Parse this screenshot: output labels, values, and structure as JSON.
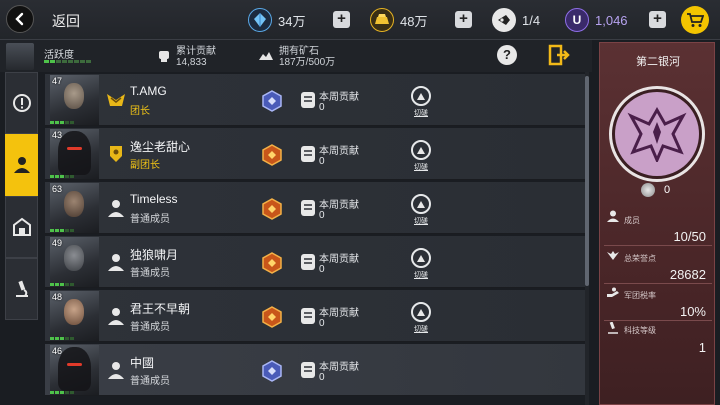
{
  "topbar": {
    "back_label": "返回",
    "crystal": "34万",
    "gold": "48万",
    "energy": "1/4",
    "premium": "1,046"
  },
  "infobar": {
    "activity_label": "活跃度",
    "total_contrib_label": "累计贡献",
    "total_contrib_value": "14,833",
    "ore_label": "拥有矿石",
    "ore_value": "187万/500万"
  },
  "members": [
    {
      "level": "47",
      "name": "T.AMG",
      "role": "团长",
      "role_color": "gold",
      "rank": "leader",
      "contrib_label": "本周贡献",
      "contrib_value": "0",
      "switch_label": "切磋"
    },
    {
      "level": "43",
      "name": "逸尘老甜心",
      "role": "副团长",
      "role_color": "gold",
      "rank": "deputy",
      "contrib_label": "本周贡献",
      "contrib_value": "0",
      "switch_label": "切磋"
    },
    {
      "level": "63",
      "name": "Timeless",
      "role": "普通成员",
      "role_color": "white",
      "rank": "member",
      "contrib_label": "本周贡献",
      "contrib_value": "0",
      "switch_label": "切磋"
    },
    {
      "level": "49",
      "name": "独狼啸月",
      "role": "普通成员",
      "role_color": "white",
      "rank": "member",
      "contrib_label": "本周贡献",
      "contrib_value": "0",
      "switch_label": "切磋"
    },
    {
      "level": "48",
      "name": "君王不早朝",
      "role": "普通成员",
      "role_color": "white",
      "rank": "member",
      "contrib_label": "本周贡献",
      "contrib_value": "0",
      "switch_label": "切磋"
    },
    {
      "level": "46",
      "name": "中國",
      "role": "普通成员",
      "role_color": "white",
      "rank": "member",
      "contrib_label": "本周贡献",
      "contrib_value": "0",
      "switch_label": ""
    }
  ],
  "panel": {
    "title": "第二银河",
    "coin_value": "0",
    "members_label": "成员",
    "members_value": "10/50",
    "honor_label": "总荣誉点",
    "honor_value": "28682",
    "tax_label": "军团税率",
    "tax_value": "10%",
    "tech_label": "科技等级",
    "tech_value": "1"
  },
  "colors": {
    "accent": "#f4c20d",
    "panel": "#4a2628",
    "active_green": "#4ec24a",
    "premium_purple": "#7f5ad6"
  }
}
